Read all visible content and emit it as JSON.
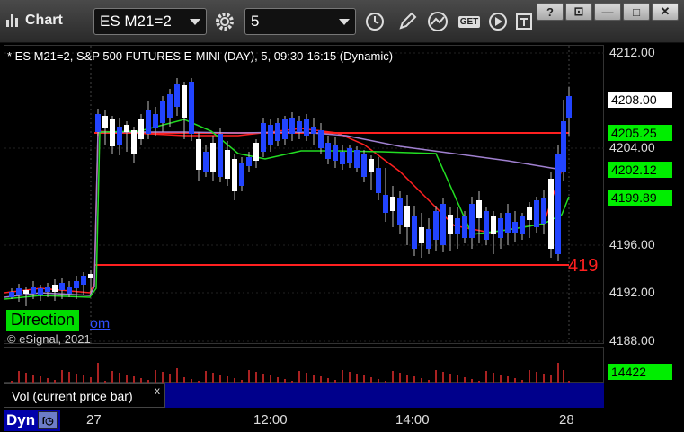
{
  "toolbar": {
    "app_title": "Chart",
    "symbol": "ES M21=2",
    "interval": "5",
    "get_label": "GET"
  },
  "window_buttons": [
    "?",
    "⊡",
    "—",
    "□",
    "✕"
  ],
  "chart": {
    "label": "* ES M21=2, S&P 500 FUTURES E-MINI (DAY), 5, 09:30-16:15 (Dynamic)",
    "watermark": "© eSignal, 2021",
    "direction_label": "Direction",
    "direction_suffix": "om",
    "price_ticks": [
      "4212.00",
      "4204.00",
      "4196.00",
      "4192.00",
      "4188.00"
    ],
    "badges": [
      {
        "text": "4208.00",
        "bg": "#ffffff",
        "fg": "#000000"
      },
      {
        "text": "4205.25",
        "bg": "#00ee00",
        "fg": "#000000"
      },
      {
        "text": "4202.12",
        "bg": "#00ee00",
        "fg": "#000000"
      },
      {
        "text": "4199.89",
        "bg": "#00ee00",
        "fg": "#000000"
      }
    ],
    "red_line_label": "419",
    "time_ticks": [
      "27",
      "12:00",
      "14:00",
      "28"
    ]
  },
  "volume": {
    "last_value": "14422",
    "study_name": "Vol (current price bar)",
    "close_label": "x"
  },
  "status": {
    "dyn_label": "Dyn"
  },
  "colors": {
    "bull_candle": "#ffffff",
    "bear_candle": "#2244ff",
    "red_line": "#ff2020",
    "green_line": "#22dd22",
    "purple_line": "#a080d0",
    "volume_bar": "#aa2222"
  }
}
